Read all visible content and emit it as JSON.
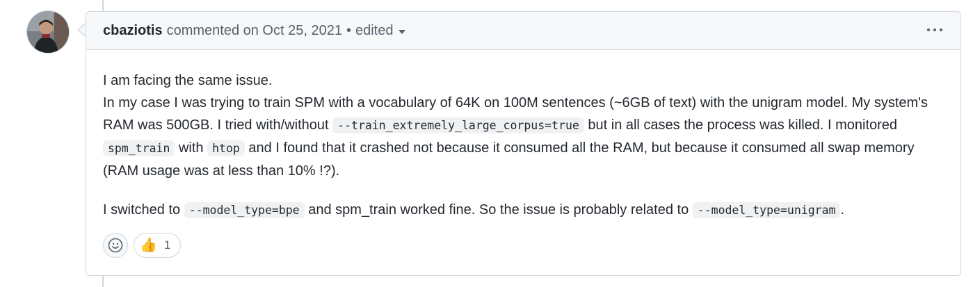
{
  "comment": {
    "author": "cbaziotis",
    "action": "commented on Oct 25, 2021",
    "separator": "•",
    "edited_label": "edited",
    "more_icon": "kebab-horizontal-icon",
    "body": {
      "p1_line1": "I am facing the same issue.",
      "p1_a": "In my case I was trying to train SPM with a vocabulary of 64K on 100M sentences (~6GB of text) with the unigram model. My system's RAM was 500GB. I tried with/without ",
      "p1_code1": "--train_extremely_large_corpus=true",
      "p1_b": " but in all cases the process was killed. I monitored ",
      "p1_code2": "spm_train",
      "p1_c": " with ",
      "p1_code3": "htop",
      "p1_d": " and I found that it crashed not because it consumed all the RAM, but because it consumed all swap memory (RAM usage was at less than 10% !?).",
      "p2_a": "I switched to ",
      "p2_code1": "--model_type=bpe",
      "p2_b": " and spm_train worked fine. So the issue is probably related to ",
      "p2_code2": "--model_type=unigram",
      "p2_c": "."
    },
    "reactions": {
      "add_icon": "smiley-icon",
      "thumbs_up": {
        "emoji": "👍",
        "count": "1"
      }
    }
  },
  "colors": {
    "border": "#d0d7de",
    "header_bg": "#f6f8fa",
    "text": "#24292f",
    "muted": "#57606a",
    "code_bg": "#eff1f3"
  }
}
